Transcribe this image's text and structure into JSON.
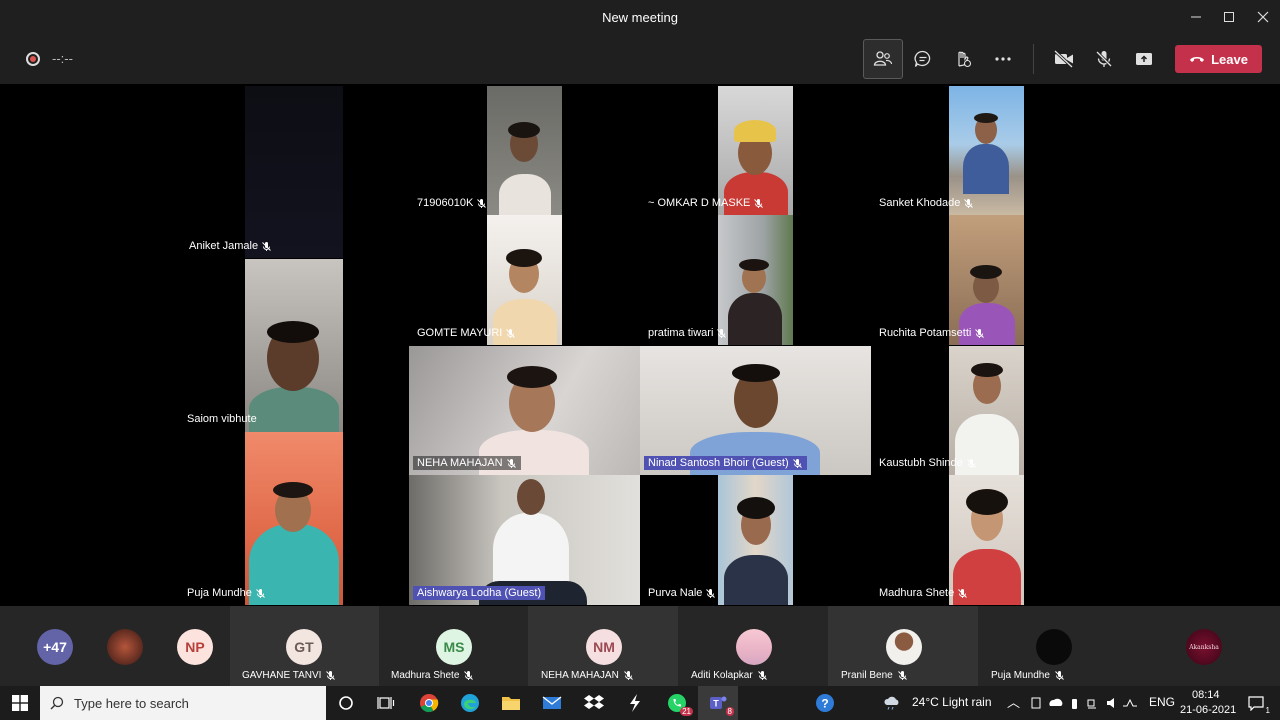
{
  "window": {
    "title": "New meeting"
  },
  "controls": {
    "timer": "--:--",
    "leave_label": "Leave"
  },
  "tiles": [
    {
      "name": "Aniket Jamale"
    },
    {
      "name": "71906010K"
    },
    {
      "name": "~ OMKAR D MASKE"
    },
    {
      "name": "Sanket Khodade"
    },
    {
      "name": "GOMTE MAYURI"
    },
    {
      "name": "pratima tiwari"
    },
    {
      "name": "Ruchita Potamsetti"
    },
    {
      "name": "Saiom vibhute"
    },
    {
      "name": "NEHA MAHAJAN"
    },
    {
      "name": "Ninad Santosh Bhoir (Guest)"
    },
    {
      "name": "Kaustubh Shinde"
    },
    {
      "name": "Puja Mundhe"
    },
    {
      "name": "Aishwarya Lodha (Guest)"
    },
    {
      "name": "Purva Nale"
    },
    {
      "name": "Madhura  Shete"
    }
  ],
  "strip": {
    "overflow": "+47",
    "people": [
      {
        "initials": "",
        "name": ""
      },
      {
        "initials": "NP",
        "name": ""
      },
      {
        "initials": "GT",
        "name": "GAVHANE TANVI"
      },
      {
        "initials": "MS",
        "name": "Madhura Shete"
      },
      {
        "initials": "NM",
        "name": "NEHA MAHAJAN"
      },
      {
        "initials": "",
        "name": "Aditi Kolapkar"
      },
      {
        "initials": "",
        "name": "Pranil Bene"
      },
      {
        "initials": "",
        "name": "Puja Mundhe"
      },
      {
        "initials": "Akanksha",
        "name": ""
      }
    ]
  },
  "taskbar": {
    "search_placeholder": "Type here to search",
    "whatsapp_badge": "21",
    "teams_badge": "8",
    "weather": "24°C  Light rain",
    "lang": "ENG",
    "time": "08:14",
    "date": "21-06-2021",
    "notifications": "1"
  }
}
